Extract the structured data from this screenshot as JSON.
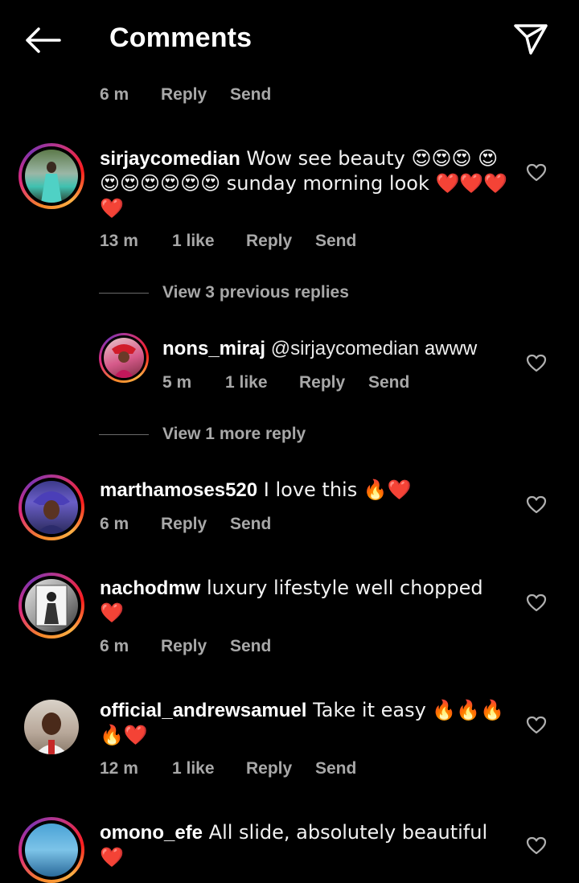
{
  "header": {
    "title": "Comments"
  },
  "top_meta": {
    "time": "6 m",
    "reply": "Reply",
    "send": "Send"
  },
  "comments": [
    {
      "username": "sirjaycomedian",
      "text": " Wow see beauty 😍😍😍 😍😍😍😍😍😍😍 sunday morning look ❤️❤️❤️❤️",
      "time": "13 m",
      "likes": "1 like",
      "reply": "Reply",
      "send": "Send"
    },
    {
      "username": "marthamoses520",
      "text": " I love this 🔥❤️",
      "time": "6 m",
      "reply": "Reply",
      "send": "Send"
    },
    {
      "username": "nachodmw",
      "text": " luxury lifestyle well chopped ❤️",
      "time": "6 m",
      "reply": "Reply",
      "send": "Send"
    },
    {
      "username": "official_andrewsamuel",
      "text": " Take it easy 🔥🔥🔥 🔥❤️",
      "time": "12 m",
      "likes": "1 like",
      "reply": "Reply",
      "send": "Send"
    },
    {
      "username": "omono_efe",
      "text": " All slide, absolutely beautiful ❤️"
    }
  ],
  "thread": {
    "view_previous": "View 3 previous replies",
    "reply": {
      "username": "nons_miraj",
      "mention": " @sirjaycomedian",
      "text": " awww",
      "time": "5 m",
      "likes": "1 like",
      "reply": "Reply",
      "send": "Send"
    },
    "view_more": "View 1 more reply"
  },
  "icons": {
    "back": "arrow-left-icon",
    "send": "paper-plane-icon",
    "like": "heart-outline-icon"
  },
  "colors": {
    "background": "#000000",
    "meta_text": "#a8a8a8",
    "story_ring": "#dd2a7b"
  }
}
